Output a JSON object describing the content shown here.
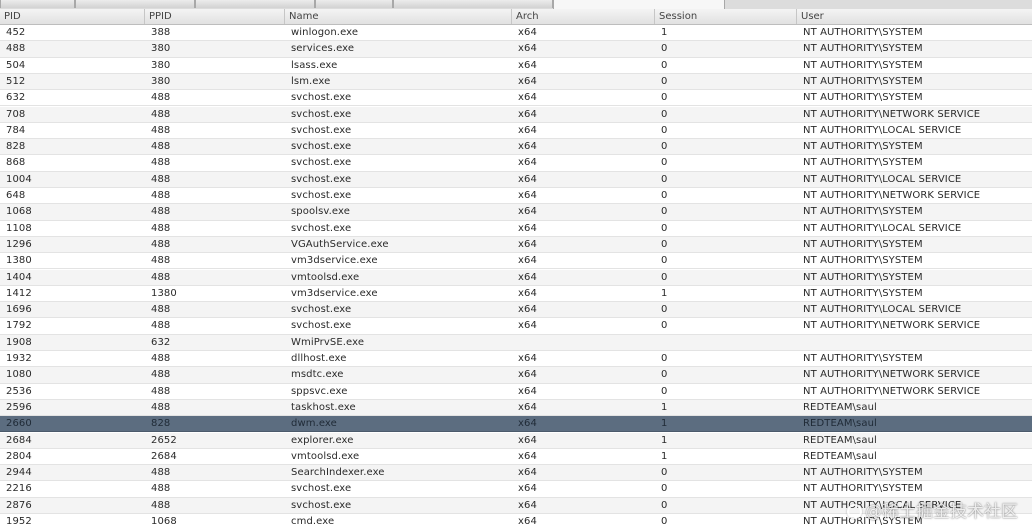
{
  "columns": {
    "pid": "PID",
    "ppid": "PPID",
    "name": "Name",
    "arch": "Arch",
    "session": "Session",
    "user": "User"
  },
  "selected_index": 24,
  "processes": [
    {
      "pid": "452",
      "ppid": "388",
      "name": "winlogon.exe",
      "arch": "x64",
      "session": "1",
      "user": "NT AUTHORITY\\SYSTEM"
    },
    {
      "pid": "488",
      "ppid": "380",
      "name": "services.exe",
      "arch": "x64",
      "session": "0",
      "user": "NT AUTHORITY\\SYSTEM"
    },
    {
      "pid": "504",
      "ppid": "380",
      "name": "lsass.exe",
      "arch": "x64",
      "session": "0",
      "user": "NT AUTHORITY\\SYSTEM"
    },
    {
      "pid": "512",
      "ppid": "380",
      "name": "lsm.exe",
      "arch": "x64",
      "session": "0",
      "user": "NT AUTHORITY\\SYSTEM"
    },
    {
      "pid": "632",
      "ppid": "488",
      "name": "svchost.exe",
      "arch": "x64",
      "session": "0",
      "user": "NT AUTHORITY\\SYSTEM"
    },
    {
      "pid": "708",
      "ppid": "488",
      "name": "svchost.exe",
      "arch": "x64",
      "session": "0",
      "user": "NT AUTHORITY\\NETWORK SERVICE"
    },
    {
      "pid": "784",
      "ppid": "488",
      "name": "svchost.exe",
      "arch": "x64",
      "session": "0",
      "user": "NT AUTHORITY\\LOCAL SERVICE"
    },
    {
      "pid": "828",
      "ppid": "488",
      "name": "svchost.exe",
      "arch": "x64",
      "session": "0",
      "user": "NT AUTHORITY\\SYSTEM"
    },
    {
      "pid": "868",
      "ppid": "488",
      "name": "svchost.exe",
      "arch": "x64",
      "session": "0",
      "user": "NT AUTHORITY\\SYSTEM"
    },
    {
      "pid": "1004",
      "ppid": "488",
      "name": "svchost.exe",
      "arch": "x64",
      "session": "0",
      "user": "NT AUTHORITY\\LOCAL SERVICE"
    },
    {
      "pid": "648",
      "ppid": "488",
      "name": "svchost.exe",
      "arch": "x64",
      "session": "0",
      "user": "NT AUTHORITY\\NETWORK SERVICE"
    },
    {
      "pid": "1068",
      "ppid": "488",
      "name": "spoolsv.exe",
      "arch": "x64",
      "session": "0",
      "user": "NT AUTHORITY\\SYSTEM"
    },
    {
      "pid": "1108",
      "ppid": "488",
      "name": "svchost.exe",
      "arch": "x64",
      "session": "0",
      "user": "NT AUTHORITY\\LOCAL SERVICE"
    },
    {
      "pid": "1296",
      "ppid": "488",
      "name": "VGAuthService.exe",
      "arch": "x64",
      "session": "0",
      "user": "NT AUTHORITY\\SYSTEM"
    },
    {
      "pid": "1380",
      "ppid": "488",
      "name": "vm3dservice.exe",
      "arch": "x64",
      "session": "0",
      "user": "NT AUTHORITY\\SYSTEM"
    },
    {
      "pid": "1404",
      "ppid": "488",
      "name": "vmtoolsd.exe",
      "arch": "x64",
      "session": "0",
      "user": "NT AUTHORITY\\SYSTEM"
    },
    {
      "pid": "1412",
      "ppid": "1380",
      "name": "vm3dservice.exe",
      "arch": "x64",
      "session": "1",
      "user": "NT AUTHORITY\\SYSTEM"
    },
    {
      "pid": "1696",
      "ppid": "488",
      "name": "svchost.exe",
      "arch": "x64",
      "session": "0",
      "user": "NT AUTHORITY\\LOCAL SERVICE"
    },
    {
      "pid": "1792",
      "ppid": "488",
      "name": "svchost.exe",
      "arch": "x64",
      "session": "0",
      "user": "NT AUTHORITY\\NETWORK SERVICE"
    },
    {
      "pid": "1908",
      "ppid": "632",
      "name": "WmiPrvSE.exe",
      "arch": "",
      "session": "",
      "user": ""
    },
    {
      "pid": "1932",
      "ppid": "488",
      "name": "dllhost.exe",
      "arch": "x64",
      "session": "0",
      "user": "NT AUTHORITY\\SYSTEM"
    },
    {
      "pid": "1080",
      "ppid": "488",
      "name": "msdtc.exe",
      "arch": "x64",
      "session": "0",
      "user": "NT AUTHORITY\\NETWORK SERVICE"
    },
    {
      "pid": "2536",
      "ppid": "488",
      "name": "sppsvc.exe",
      "arch": "x64",
      "session": "0",
      "user": "NT AUTHORITY\\NETWORK SERVICE"
    },
    {
      "pid": "2596",
      "ppid": "488",
      "name": "taskhost.exe",
      "arch": "x64",
      "session": "1",
      "user": "REDTEAM\\saul"
    },
    {
      "pid": "2660",
      "ppid": "828",
      "name": "dwm.exe",
      "arch": "x64",
      "session": "1",
      "user": "REDTEAM\\saul"
    },
    {
      "pid": "2684",
      "ppid": "2652",
      "name": "explorer.exe",
      "arch": "x64",
      "session": "1",
      "user": "REDTEAM\\saul"
    },
    {
      "pid": "2804",
      "ppid": "2684",
      "name": "vmtoolsd.exe",
      "arch": "x64",
      "session": "1",
      "user": "REDTEAM\\saul"
    },
    {
      "pid": "2944",
      "ppid": "488",
      "name": "SearchIndexer.exe",
      "arch": "x64",
      "session": "0",
      "user": "NT AUTHORITY\\SYSTEM"
    },
    {
      "pid": "2216",
      "ppid": "488",
      "name": "svchost.exe",
      "arch": "x64",
      "session": "0",
      "user": "NT AUTHORITY\\SYSTEM"
    },
    {
      "pid": "2876",
      "ppid": "488",
      "name": "svchost.exe",
      "arch": "x64",
      "session": "0",
      "user": "NT AUTHORITY\\LOCAL SERVICE"
    },
    {
      "pid": "1952",
      "ppid": "1068",
      "name": "cmd.exe",
      "arch": "x64",
      "session": "0",
      "user": "NT AUTHORITY\\SYSTEM"
    }
  ],
  "watermark": "@稀土掘金技术社区"
}
